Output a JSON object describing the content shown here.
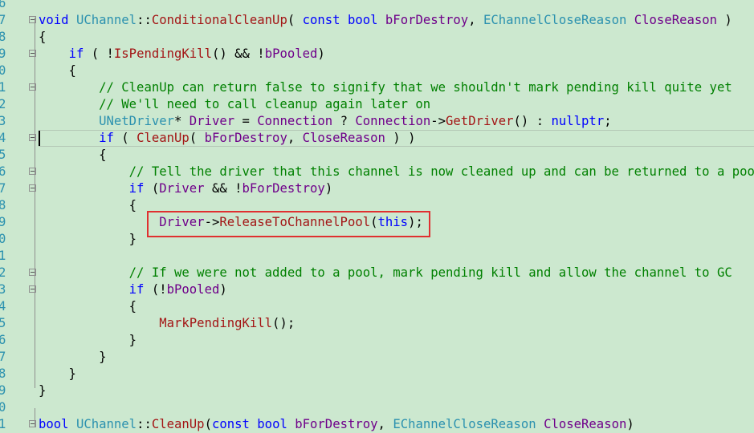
{
  "colors": {
    "background": "#cce8cf",
    "keyword": "#0000ff",
    "type": "#2b91af",
    "function": "#a31515",
    "comment": "#008000",
    "plain": "#000000",
    "macro": "#6f008a",
    "line_number": "#2b91af",
    "highlight_border": "#e03030"
  },
  "lines": [
    {
      "num": "6",
      "tokens": []
    },
    {
      "num": "7",
      "fold": true,
      "tokens": [
        [
          "kw",
          "void"
        ],
        [
          "pl",
          " "
        ],
        [
          "ty",
          "UChannel"
        ],
        [
          "pl",
          "::"
        ],
        [
          "fn",
          "ConditionalCleanUp"
        ],
        [
          "pl",
          "( "
        ],
        [
          "kw",
          "const"
        ],
        [
          "pl",
          " "
        ],
        [
          "kw",
          "bool"
        ],
        [
          "pl",
          " "
        ],
        [
          "id",
          "bForDestroy"
        ],
        [
          "pl",
          ", "
        ],
        [
          "ty",
          "EChannelCloseReason"
        ],
        [
          "pl",
          " "
        ],
        [
          "id",
          "CloseReason"
        ],
        [
          "pl",
          " )"
        ]
      ]
    },
    {
      "num": "8",
      "tokens": [
        [
          "pl",
          "{"
        ]
      ]
    },
    {
      "num": "9",
      "fold": true,
      "tokens": [
        [
          "pl",
          "    "
        ],
        [
          "kw",
          "if"
        ],
        [
          "pl",
          " ( !"
        ],
        [
          "fn",
          "IsPendingKill"
        ],
        [
          "pl",
          "() && !"
        ],
        [
          "id",
          "bPooled"
        ],
        [
          "pl",
          ")"
        ]
      ]
    },
    {
      "num": "0",
      "tokens": [
        [
          "pl",
          "    {"
        ]
      ]
    },
    {
      "num": "1",
      "fold": true,
      "tokens": [
        [
          "pl",
          "        "
        ],
        [
          "cm",
          "// CleanUp can return false to signify that we shouldn't mark pending kill quite yet"
        ]
      ]
    },
    {
      "num": "2",
      "tokens": [
        [
          "pl",
          "        "
        ],
        [
          "cm",
          "// We'll need to call cleanup again later on"
        ]
      ]
    },
    {
      "num": "3",
      "tokens": [
        [
          "pl",
          "        "
        ],
        [
          "ty",
          "UNetDriver"
        ],
        [
          "pl",
          "* "
        ],
        [
          "id",
          "Driver"
        ],
        [
          "pl",
          " = "
        ],
        [
          "id",
          "Connection"
        ],
        [
          "pl",
          " ? "
        ],
        [
          "id",
          "Connection"
        ],
        [
          "pl",
          "->"
        ],
        [
          "fn",
          "GetDriver"
        ],
        [
          "pl",
          "() : "
        ],
        [
          "kw",
          "nullptr"
        ],
        [
          "pl",
          ";"
        ]
      ]
    },
    {
      "num": "4",
      "fold": true,
      "current": true,
      "tokens": [
        [
          "pl",
          "        "
        ],
        [
          "kw",
          "if"
        ],
        [
          "pl",
          " ( "
        ],
        [
          "fn",
          "CleanUp"
        ],
        [
          "pl",
          "( "
        ],
        [
          "id",
          "bForDestroy"
        ],
        [
          "pl",
          ", "
        ],
        [
          "id",
          "CloseReason"
        ],
        [
          "pl",
          " ) )"
        ]
      ]
    },
    {
      "num": "5",
      "tokens": [
        [
          "pl",
          "        {"
        ]
      ]
    },
    {
      "num": "6",
      "fold": true,
      "tokens": [
        [
          "pl",
          "            "
        ],
        [
          "cm",
          "// Tell the driver that this channel is now cleaned up and can be returned to a pool, i"
        ]
      ]
    },
    {
      "num": "7",
      "fold": true,
      "tokens": [
        [
          "pl",
          "            "
        ],
        [
          "kw",
          "if"
        ],
        [
          "pl",
          " ("
        ],
        [
          "id",
          "Driver"
        ],
        [
          "pl",
          " && !"
        ],
        [
          "id",
          "bForDestroy"
        ],
        [
          "pl",
          ")"
        ]
      ]
    },
    {
      "num": "8",
      "tokens": [
        [
          "pl",
          "            {"
        ]
      ]
    },
    {
      "num": "9",
      "tokens": [
        [
          "pl",
          "                "
        ],
        [
          "id",
          "Driver"
        ],
        [
          "pl",
          "->"
        ],
        [
          "fn",
          "ReleaseToChannelPool"
        ],
        [
          "pl",
          "("
        ],
        [
          "kw",
          "this"
        ],
        [
          "pl",
          ");"
        ]
      ]
    },
    {
      "num": "0",
      "tokens": [
        [
          "pl",
          "            }"
        ]
      ]
    },
    {
      "num": "1",
      "tokens": []
    },
    {
      "num": "2",
      "fold": true,
      "tokens": [
        [
          "pl",
          "            "
        ],
        [
          "cm",
          "// If we were not added to a pool, mark pending kill and allow the channel to GC"
        ]
      ]
    },
    {
      "num": "3",
      "fold": true,
      "tokens": [
        [
          "pl",
          "            "
        ],
        [
          "kw",
          "if"
        ],
        [
          "pl",
          " (!"
        ],
        [
          "id",
          "bPooled"
        ],
        [
          "pl",
          ")"
        ]
      ]
    },
    {
      "num": "4",
      "tokens": [
        [
          "pl",
          "            {"
        ]
      ]
    },
    {
      "num": "5",
      "tokens": [
        [
          "pl",
          "                "
        ],
        [
          "fn",
          "MarkPendingKill"
        ],
        [
          "pl",
          "();"
        ]
      ]
    },
    {
      "num": "6",
      "tokens": [
        [
          "pl",
          "            }"
        ]
      ]
    },
    {
      "num": "7",
      "tokens": [
        [
          "pl",
          "        }"
        ]
      ]
    },
    {
      "num": "8",
      "tokens": [
        [
          "pl",
          "    }"
        ]
      ]
    },
    {
      "num": "9",
      "tokens": [
        [
          "pl",
          "}"
        ]
      ]
    },
    {
      "num": "0",
      "tokens": []
    },
    {
      "num": "1",
      "fold": true,
      "tokens": [
        [
          "kw",
          "bool"
        ],
        [
          "pl",
          " "
        ],
        [
          "ty",
          "UChannel"
        ],
        [
          "pl",
          "::"
        ],
        [
          "fn",
          "CleanUp"
        ],
        [
          "pl",
          "("
        ],
        [
          "kw",
          "const"
        ],
        [
          "pl",
          " "
        ],
        [
          "kw",
          "bool"
        ],
        [
          "pl",
          " "
        ],
        [
          "id",
          "bForDestroy"
        ],
        [
          "pl",
          ", "
        ],
        [
          "ty",
          "EChannelCloseReason"
        ],
        [
          "pl",
          " "
        ],
        [
          "id",
          "CloseReason"
        ],
        [
          "pl",
          ")"
        ]
      ]
    }
  ]
}
